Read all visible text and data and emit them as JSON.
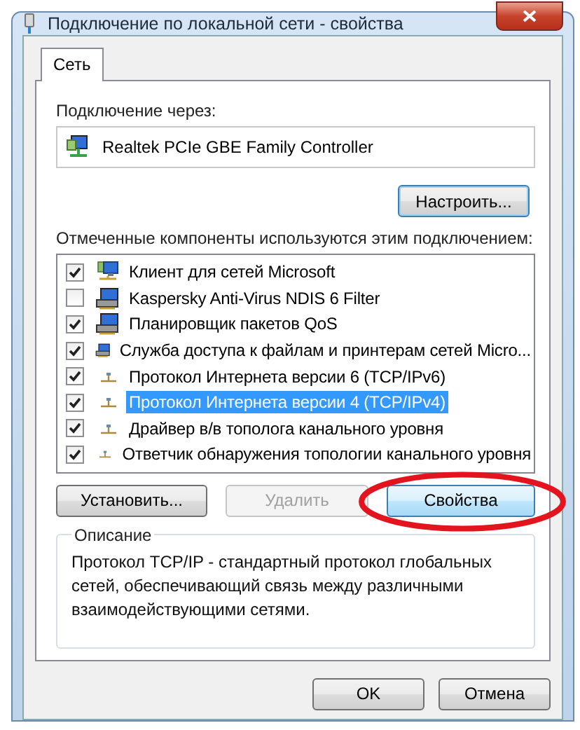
{
  "window": {
    "title": "Подключение по локальной сети - свойства"
  },
  "tabs": [
    {
      "label": "Сеть",
      "selected": true
    }
  ],
  "connect_using": {
    "label": "Подключение через:",
    "adapter": "Realtek PCIe GBE Family Controller"
  },
  "configure_button": "Настроить...",
  "components": {
    "label": "Отмеченные компоненты используются этим подключением:",
    "items": [
      {
        "kind": "client",
        "name": "Клиент для сетей Microsoft",
        "checked": true,
        "selected": false
      },
      {
        "kind": "service",
        "name": "Kaspersky Anti-Virus NDIS 6 Filter",
        "checked": false,
        "selected": false
      },
      {
        "kind": "service",
        "name": "Планировщик пакетов QoS",
        "checked": true,
        "selected": false
      },
      {
        "kind": "service",
        "name": "Служба доступа к файлам и принтерам сетей Micro...",
        "checked": true,
        "selected": false
      },
      {
        "kind": "protocol",
        "name": "Протокол Интернета версии 6 (TCP/IPv6)",
        "checked": true,
        "selected": false
      },
      {
        "kind": "protocol",
        "name": "Протокол Интернета версии 4 (TCP/IPv4)",
        "checked": true,
        "selected": true
      },
      {
        "kind": "protocol",
        "name": "Драйвер в/в тополога канального уровня",
        "checked": true,
        "selected": false
      },
      {
        "kind": "protocol",
        "name": "Ответчик обнаружения топологии канального уровня",
        "checked": true,
        "selected": false
      }
    ]
  },
  "component_buttons": [
    {
      "label": "Установить...",
      "disabled": false,
      "circled": false
    },
    {
      "label": "Удалить",
      "disabled": true,
      "circled": false
    },
    {
      "label": "Свойства",
      "disabled": false,
      "circled": true
    }
  ],
  "description": {
    "title": "Описание",
    "text": "Протокол TCP/IP - стандартный протокол глобальных сетей, обеспечивающий связь между различными взаимодействующими сетями."
  },
  "dialog_buttons": [
    "OK",
    "Отмена"
  ]
}
